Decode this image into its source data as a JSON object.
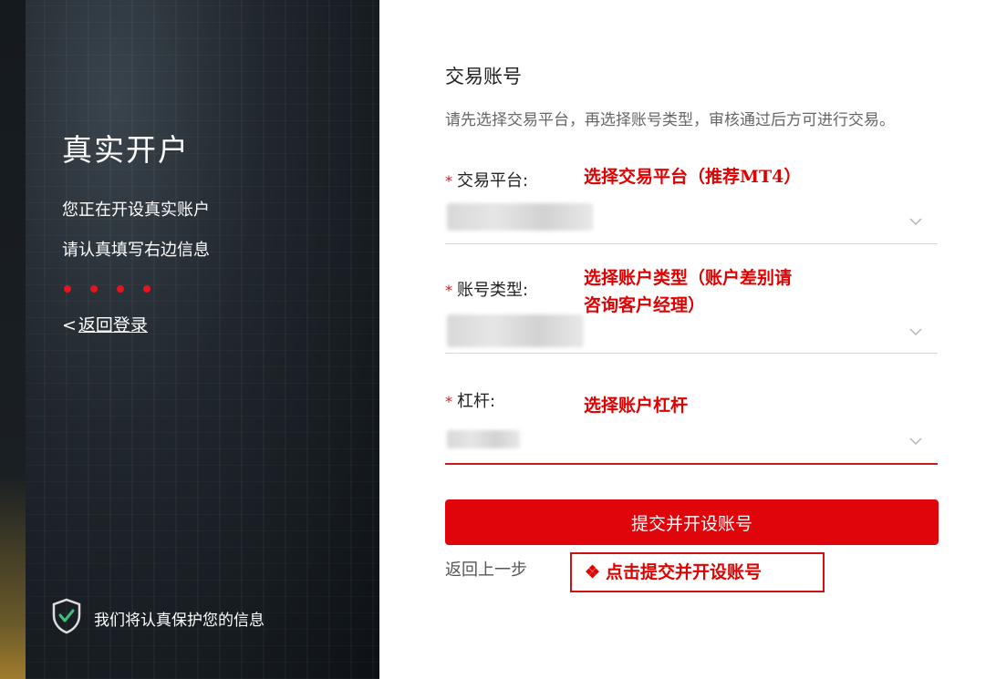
{
  "left": {
    "title": "真实开户",
    "line1": "您正在开设真实账户",
    "line2": "请认真填写右边信息",
    "back_icon": "<",
    "back_label": "返回登录",
    "secure_text": "我们将认真保护您的信息"
  },
  "form": {
    "title": "交易账号",
    "description": "请先选择交易平台，再选择账号类型，审核通过后方可进行交易。",
    "required_mark": "*",
    "fields": [
      {
        "label": "交易平台:",
        "annotation": "选择交易平台（推荐MT4）"
      },
      {
        "label": "账号类型:",
        "annotation_line1": "选择账户类型（账户差别请",
        "annotation_line2": "咨询客户经理）"
      },
      {
        "label": "杠杆:",
        "annotation": "选择账户杠杆"
      }
    ],
    "submit_label": "提交并开设账号",
    "back_step_label": "返回上一步",
    "callout_icon": "❖",
    "callout_text": "点击提交并开设账号"
  },
  "icons": {
    "shield": "shield-check-icon",
    "chevron": "chevron-down-icon"
  },
  "colors": {
    "accent": "#e0050a",
    "annotation": "#e00000",
    "panel_bg": "#1c2226"
  }
}
